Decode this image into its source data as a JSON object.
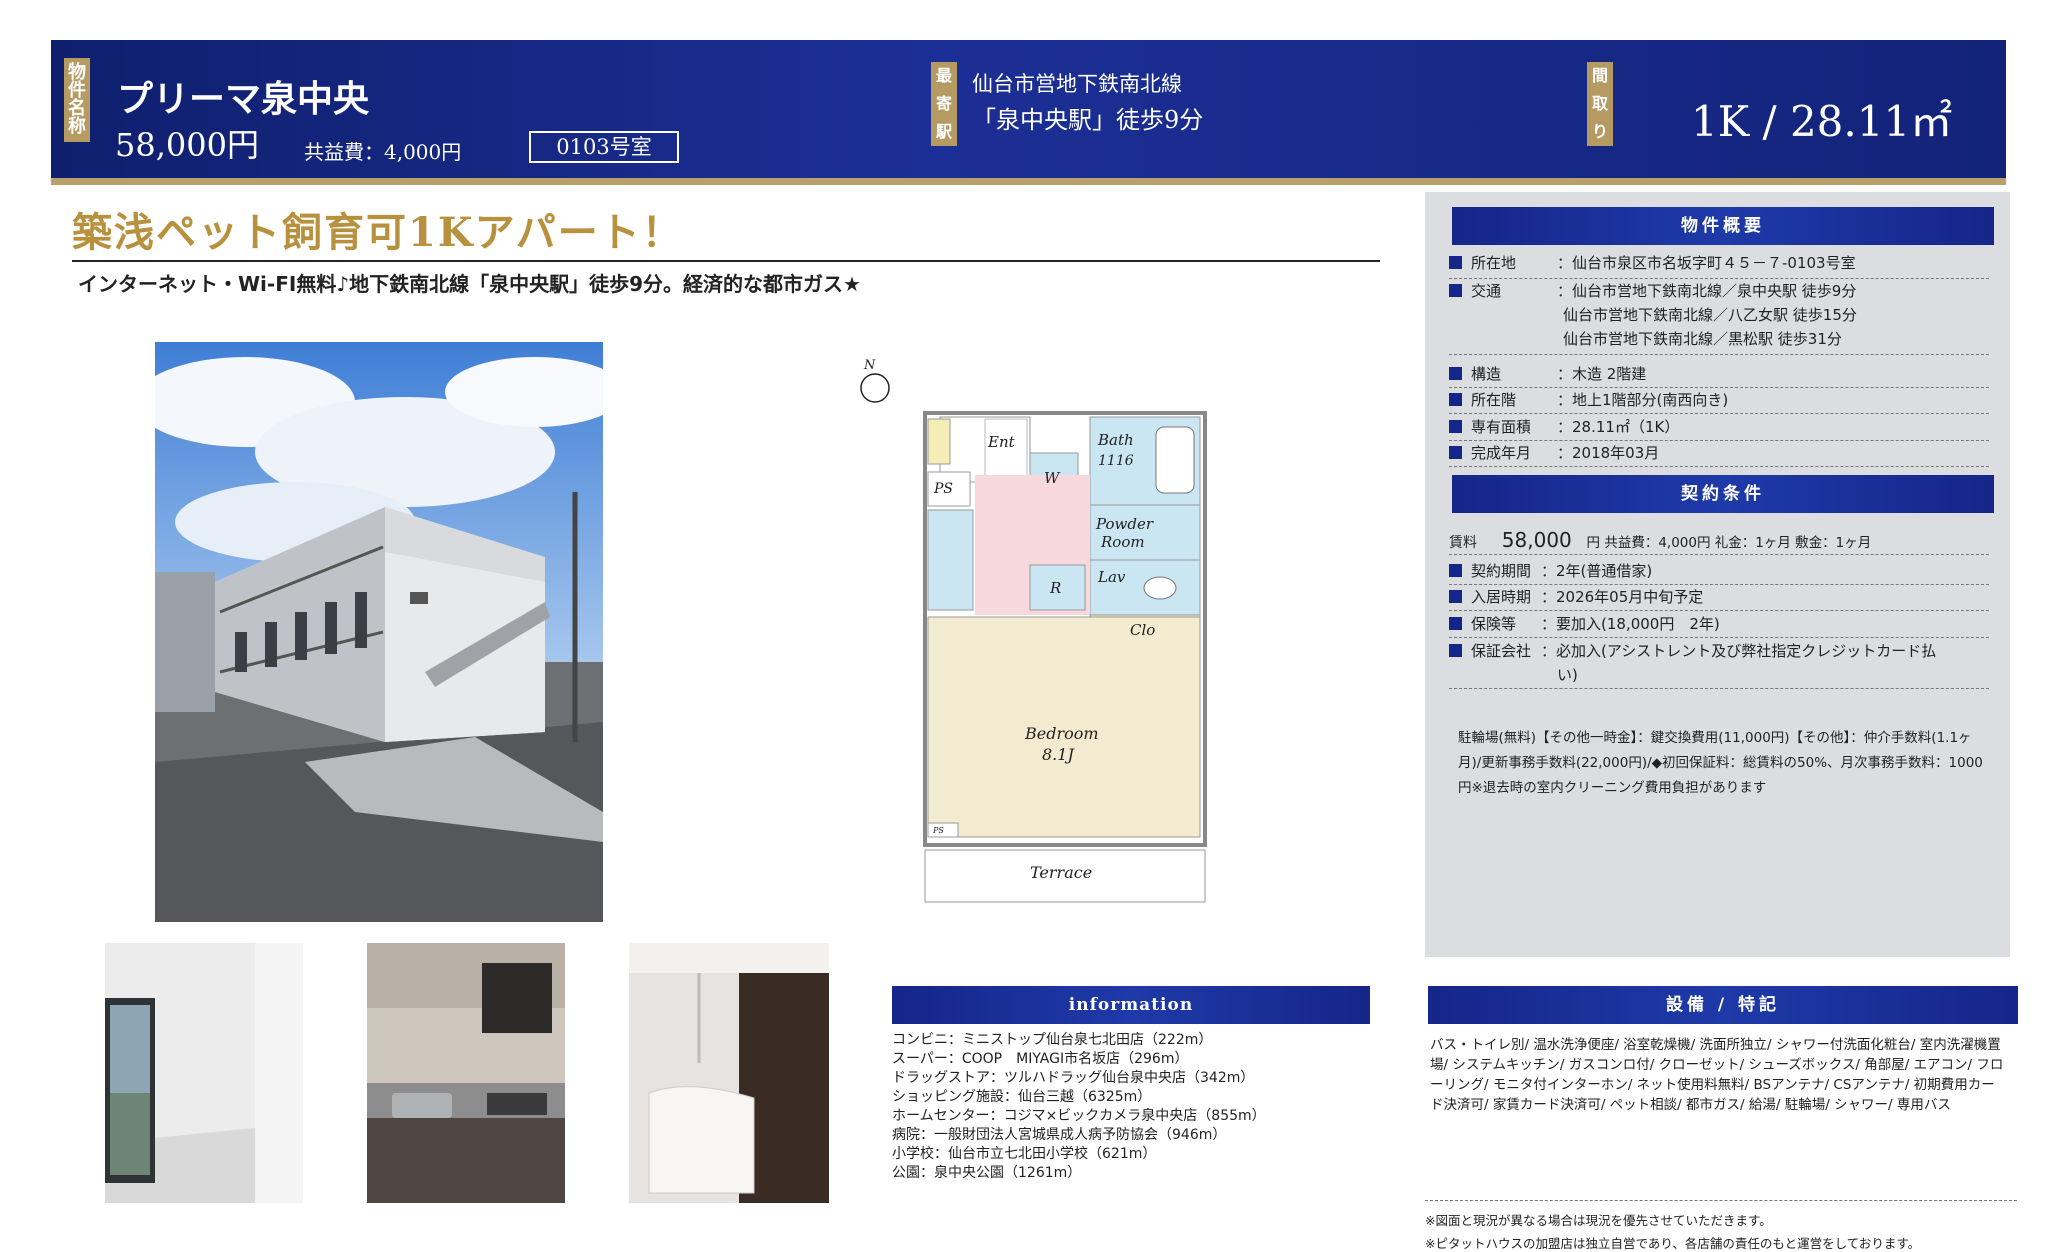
{
  "header": {
    "name_tag": "物件名称",
    "property_name": "プリーマ泉中央",
    "rent": "58,000円",
    "common_fee": "共益費：4,000円",
    "room_number": "0103号室",
    "station_tag": "最寄駅",
    "line": "仙台市営地下鉄南北線",
    "station": "「泉中央駅」徒歩9分",
    "layout_tag": "間取り",
    "layout": "1K / 28.11㎡"
  },
  "catch": {
    "headline": "築浅ペット飼育可1Kアパート！",
    "subline": "インターネット・Wi-FI無料♪地下鉄南北線「泉中央駅」徒歩9分。経済的な都市ガス★"
  },
  "summary": {
    "title": "物件概要",
    "rows": [
      {
        "label": "所在地",
        "value": "：仙台市泉区市名坂字町４５－７-0103号室"
      },
      {
        "label": "交通",
        "value": "：仙台市営地下鉄南北線／泉中央駅 徒歩9分"
      },
      {
        "label": "",
        "value": "仙台市営地下鉄南北線／八乙女駅 徒歩15分"
      },
      {
        "label": "",
        "value": "仙台市営地下鉄南北線／黒松駅 徒歩31分"
      },
      {
        "label": "構造",
        "value": "：木造 2階建"
      },
      {
        "label": "所在階",
        "value": "：地上1階部分(南西向き)"
      },
      {
        "label": "専有面積",
        "value": "：28.11㎡（1K）"
      },
      {
        "label": "完成年月",
        "value": "：2018年03月"
      }
    ]
  },
  "contract": {
    "title": "契約条件",
    "rent_label": "賃料",
    "rent_value": "58,000",
    "rent_rest": "円 共益費：4,000円 礼金：1ヶ月 敷金：1ヶ月",
    "rows": [
      {
        "label": "契約期間",
        "value": "：2年(普通借家)"
      },
      {
        "label": "入居時期",
        "value": "：2026年05月中旬予定"
      },
      {
        "label": "保険等",
        "value": "：要加入(18,000円　2年)"
      },
      {
        "label": "保証会社",
        "value": "：必加入(アシストレント及び弊社指定クレジットカード払"
      },
      {
        "label": "",
        "value": "い)"
      }
    ],
    "notes": "駐輪場(無料)【その他一時金】：鍵交換費用(11,000円)【その他】：仲介手数料(1.1ヶ月)/更新事務手数料(22,000円)/◆初回保証料：総賃料の50%、月次事務手数料：1000円※退去時の室内クリーニング費用負担があります"
  },
  "floorplan": {
    "north": "N",
    "rooms": [
      "Ent",
      "W",
      "PS",
      "Bath",
      "1116",
      "Powder",
      "Room",
      "Lav",
      "R",
      "Clo",
      "Bedroom",
      "8.1J",
      "PS",
      "Terrace"
    ]
  },
  "information": {
    "title": "information",
    "items": [
      "コンビニ：ミニストップ仙台泉七北田店（222m）",
      "スーパー：COOP　MIYAGI市名坂店（296m）",
      "ドラッグストア：ツルハドラッグ仙台泉中央店（342m）",
      "ショッピング施設：仙台三越（6325m）",
      "ホームセンター：コジマ×ビックカメラ泉中央店（855m）",
      "病院：一般財団法人宮城県成人病予防協会（946m）",
      "小学校：仙台市立七北田小学校（621m）",
      "公園：泉中央公園（1261m）"
    ]
  },
  "features": {
    "title": "設備 / 特記",
    "text": "バス・トイレ別/ 温水洗浄便座/ 浴室乾燥機/ 洗面所独立/ シャワー付洗面化粧台/ 室内洗濯機置場/ システムキッチン/ ガスコンロ付/ クローゼット/ シューズボックス/ 角部屋/ エアコン/ フローリング/ モニタ付インターホン/ ネット使用料無料/ BSアンテナ/ CSアンテナ/ 初期費用カード決済可/ 家賃カード決済可/ ペット相談/ 都市ガス/ 給湯/ 駐輪場/ シャワー/ 専用バス"
  },
  "disclaimer": {
    "line1": "※図面と現況が異なる場合は現況を優先させていただきます。",
    "line2": "※ピタットハウスの加盟店は独立自営であり、各店舗の責任のもと運営をしております。"
  },
  "colors": {
    "navy": "#15258a",
    "gold": "#b59a62",
    "headline_gold": "#b8913e",
    "panel_gray": "#dcdde0"
  }
}
